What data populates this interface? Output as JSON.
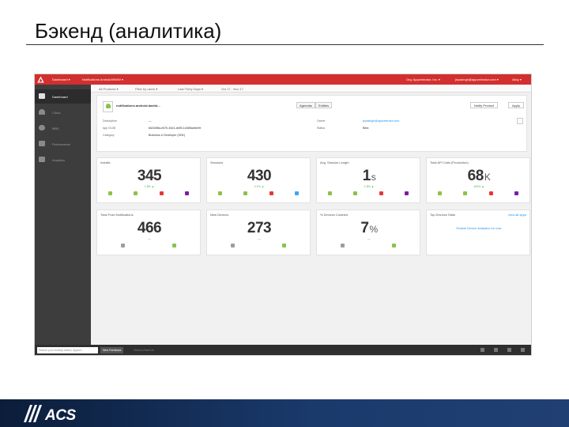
{
  "slide": {
    "title": "Бэкенд (аналитика)"
  },
  "app_shot": {
    "topbar": {
      "items": [
        "Dashboard ▾",
        "Notifications Android/WWW ▾"
      ],
      "right": [
        "Org: Appcelerator, Inc. ▾",
        "jeyasingh@appcelerator.com ▾",
        "Alloy ▾"
      ]
    },
    "sidebar": {
      "items": [
        {
          "label": "Dashboard",
          "icon": "grid-icon",
          "active": true
        },
        {
          "label": "Cloud",
          "icon": "cloud-icon",
          "active": false
        },
        {
          "label": "MBS",
          "icon": "user-icon",
          "active": false
        },
        {
          "label": "Performance",
          "icon": "home-icon",
          "active": false
        },
        {
          "label": "Analytics",
          "icon": "chart-icon",
          "active": false
        }
      ]
    },
    "subbar": {
      "crumbs": [
        "All Products ▾",
        "Filter by users ▾",
        "Last Thirty Days ▾",
        "Oct 17 - Nov 17"
      ]
    },
    "app_card": {
      "name": "notifications.android.dashb...",
      "btn_settings": "Agendas",
      "btn_entities": "Entities",
      "btn_notify": "Notify Product",
      "btn_apply": "Apply",
      "meta_left": [
        {
          "k": "Description",
          "v": "—"
        },
        {
          "k": "App GUID",
          "v": "8d2d4f8a-e67b-44d1-ab55-1d485aafcb9e"
        },
        {
          "k": "Category",
          "v": "Business & Developer (SDK)"
        }
      ],
      "meta_right": [
        {
          "k": "Owner",
          "v": "jeyasingh@appcelerator.com"
        },
        {
          "k": "Status",
          "v": "Beta"
        }
      ]
    },
    "metrics": [
      {
        "title": "Installs",
        "value": "345",
        "unit": "",
        "delta": "1.8% ▲",
        "delta_color": "green",
        "icons": [
          [
            "android",
            "#8bc34a"
          ],
          [
            "windows",
            "#8bc34a"
          ],
          [
            "html5",
            "#e53935"
          ],
          [
            "windowsphone",
            "#7b1fa2"
          ]
        ]
      },
      {
        "title": "Sessions",
        "value": "430",
        "unit": "",
        "delta": "2.1% ▲",
        "delta_color": "green",
        "icons": [
          [
            "android",
            "#8bc34a"
          ],
          [
            "windows",
            "#8bc34a"
          ],
          [
            "html5",
            "#e53935"
          ],
          [
            "web",
            "#42a5f5"
          ]
        ]
      },
      {
        "title": "Avg. Session Length",
        "value": "1",
        "unit": "s",
        "delta": "1.8% ▲",
        "delta_color": "green",
        "icons": [
          [
            "android",
            "#8bc34a"
          ],
          [
            "windows",
            "#8bc34a"
          ],
          [
            "html5",
            "#e53935"
          ],
          [
            "windowsphone",
            "#7b1fa2"
          ]
        ]
      },
      {
        "title": "Total API Calls (Production)",
        "value": "68",
        "unit": "K",
        "delta": "100% ▲",
        "delta_color": "green",
        "icons": [
          [
            "android",
            "#8bc34a"
          ],
          [
            "windows",
            "#8bc34a"
          ],
          [
            "html5",
            "#e53935"
          ],
          [
            "windowsphone",
            "#7b1fa2"
          ]
        ]
      },
      {
        "title": "Total Push Notifications",
        "value": "466",
        "unit": "",
        "delta": "—",
        "delta_color": "red",
        "icons": [
          [
            "android",
            "#9e9e9e"
          ],
          [
            "ios",
            "#8bc34a"
          ]
        ]
      },
      {
        "title": "New Devices",
        "value": "273",
        "unit": "",
        "delta": "—",
        "delta_color": "red",
        "icons": [
          [
            "android",
            "#9e9e9e"
          ],
          [
            "ios",
            "#8bc34a"
          ]
        ]
      },
      {
        "title": "% Devices Crashed",
        "value": "7",
        "unit": "%",
        "delta": "—",
        "delta_color": "red",
        "icons": [
          [
            "android",
            "#9e9e9e"
          ],
          [
            "ios",
            "#8bc34a"
          ]
        ]
      },
      {
        "title": "Top Devices Stats",
        "value": "",
        "unit": "",
        "delta": "",
        "delta_color": "green",
        "link": "view all apps",
        "note": "Enable Device Analytics for now",
        "icons": []
      }
    ],
    "bottombar": {
      "placeholder": "Search your Activity-based, Appcel...",
      "button": "New Feedback",
      "hint": "Click to Feed Us"
    }
  },
  "footer": {
    "brand": "ACS"
  }
}
